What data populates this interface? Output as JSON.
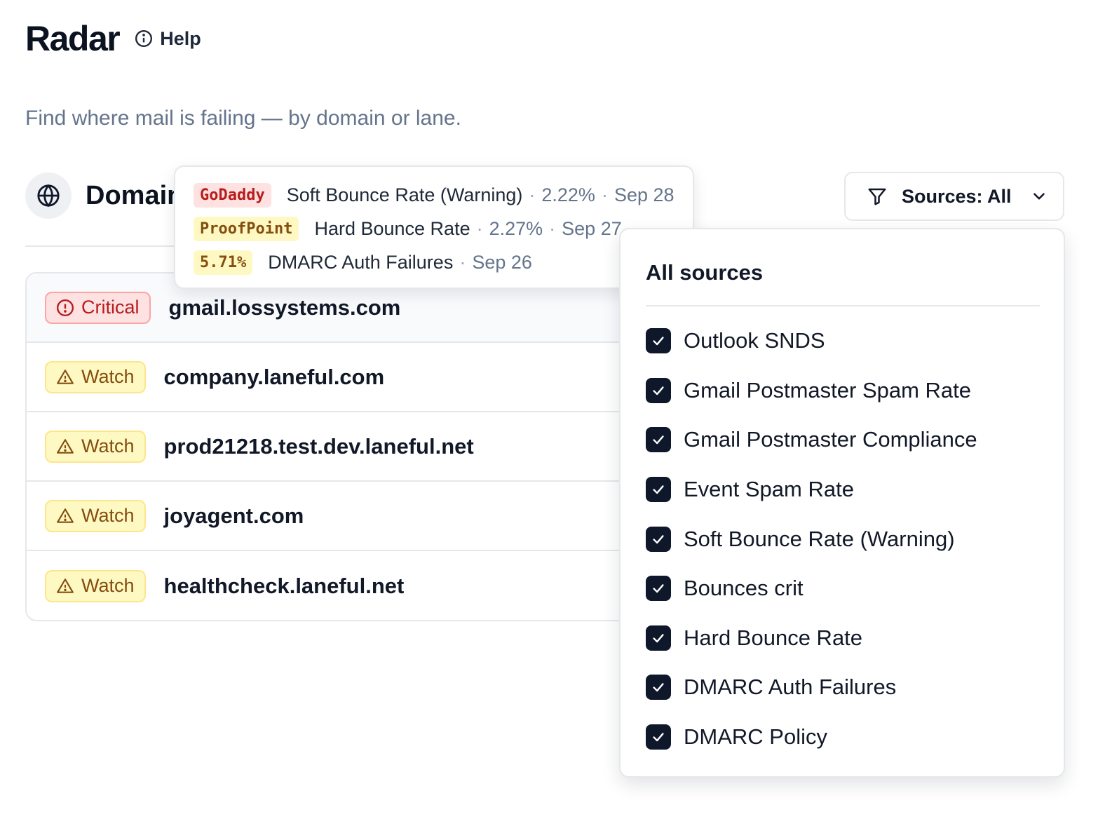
{
  "header": {
    "title": "Radar",
    "help_label": "Help"
  },
  "subtitle": "Find where mail is failing — by domain or lane.",
  "section": {
    "title": "Domain"
  },
  "domains": [
    {
      "status": "Critical",
      "name": "gmail.lossystems.com"
    },
    {
      "status": "Watch",
      "name": "company.laneful.com"
    },
    {
      "status": "Watch",
      "name": "prod21218.test.dev.laneful.net"
    },
    {
      "status": "Watch",
      "name": "joyagent.com"
    },
    {
      "status": "Watch",
      "name": "healthcheck.laneful.net"
    }
  ],
  "tooltip": {
    "rows": [
      {
        "tag": "GoDaddy",
        "metric": "Soft Bounce Rate (Warning)",
        "value": "2.22%",
        "date": "Sep 28"
      },
      {
        "tag": "ProofPoint",
        "metric": "Hard Bounce Rate",
        "value": "2.27%",
        "date": "Sep 27"
      },
      {
        "tag": "5.71%",
        "metric": "DMARC Auth Failures",
        "value": "",
        "date": "Sep 26"
      }
    ],
    "separator": "·"
  },
  "filter": {
    "button_label": "Sources: All",
    "dropdown_header": "All sources",
    "options": [
      {
        "label": "Outlook SNDS",
        "checked": true
      },
      {
        "label": "Gmail Postmaster Spam Rate",
        "checked": true
      },
      {
        "label": "Gmail Postmaster Compliance",
        "checked": true
      },
      {
        "label": "Event Spam Rate",
        "checked": true
      },
      {
        "label": "Soft Bounce Rate (Warning)",
        "checked": true
      },
      {
        "label": "Bounces crit",
        "checked": true
      },
      {
        "label": "Hard Bounce Rate",
        "checked": true
      },
      {
        "label": "DMARC Auth Failures",
        "checked": true
      },
      {
        "label": "DMARC Policy",
        "checked": true
      }
    ]
  },
  "colors": {
    "critical_bg": "#fee2e2",
    "critical_text": "#b91c1c",
    "watch_bg": "#fef9c3",
    "watch_text": "#854d0e",
    "checkbox": "#0f172a"
  },
  "icons": {
    "help": "info-circle-icon",
    "section": "globe-icon",
    "critical": "alert-circle-icon",
    "watch": "warning-triangle-icon",
    "filter": "filter-funnel-icon",
    "chevron": "chevron-down-icon",
    "check": "check-icon"
  }
}
